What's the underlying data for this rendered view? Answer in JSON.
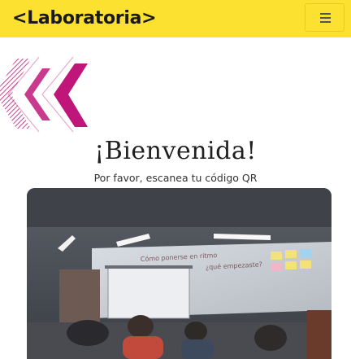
{
  "header": {
    "logo_text": "<Laboratoria>",
    "menu_icon": "hamburger-menu-icon",
    "background_color": "#fde130"
  },
  "main": {
    "decoration_icon": "double-chevron-left-decoration",
    "accent_color": "#c0167a",
    "title": "¡Bienvenida!",
    "subtitle": "Por favor, escanea tu código QR"
  },
  "camera": {
    "feed_label": "qr-camera-feed",
    "whiteboard_text_1": "Cómo ponerse en ritmo",
    "whiteboard_text_2": "¿qué empezaste?"
  }
}
